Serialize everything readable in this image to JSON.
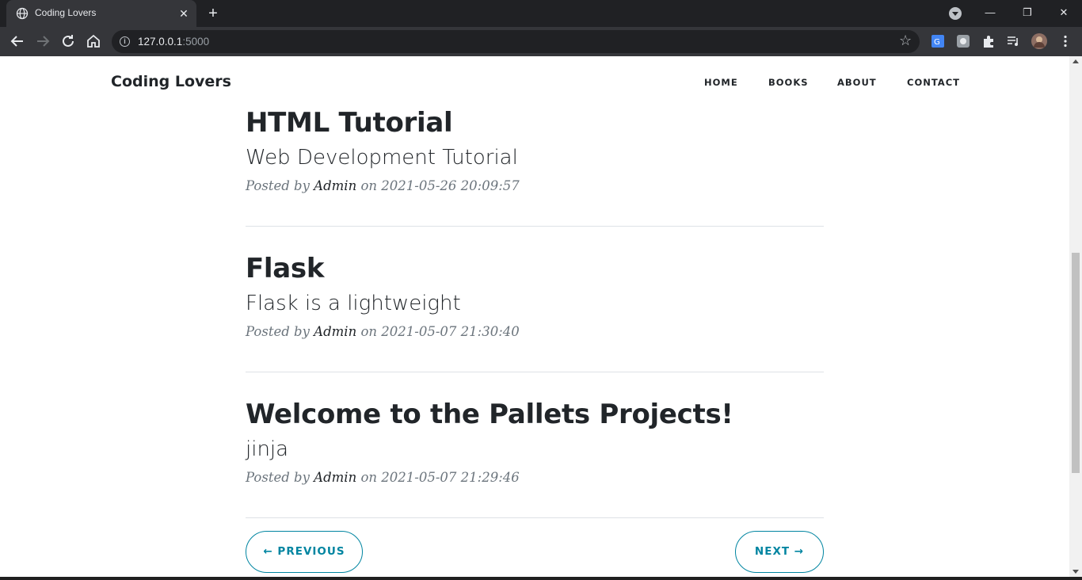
{
  "browser": {
    "tab_title": "Coding Lovers",
    "new_tab_symbol": "+",
    "close_symbol": "✕",
    "url_host": "127.0.0.1",
    "url_port": ":5000",
    "window_controls": {
      "minimize": "—",
      "restore": "❐",
      "close": "✕"
    }
  },
  "site": {
    "brand": "Coding Lovers",
    "nav": [
      "HOME",
      "BOOKS",
      "ABOUT",
      "CONTACT"
    ]
  },
  "posts": [
    {
      "title": "HTML Tutorial",
      "subtitle": "Web Development Tutorial",
      "posted_by": "Posted by",
      "author": "Admin",
      "on": "on",
      "date": "2021-05-26 20:09:57"
    },
    {
      "title": "Flask",
      "subtitle": "Flask is a lightweight",
      "posted_by": "Posted by",
      "author": "Admin",
      "on": "on",
      "date": "2021-05-07 21:30:40"
    },
    {
      "title": "Welcome to the Pallets Projects!",
      "subtitle": "jinja",
      "posted_by": "Posted by",
      "author": "Admin",
      "on": "on",
      "date": "2021-05-07 21:29:46"
    }
  ],
  "pager": {
    "previous": "← PREVIOUS",
    "next": "NEXT →"
  },
  "colors": {
    "accent": "#0085a1",
    "chrome_dark": "#202124",
    "chrome_toolbar": "#35363a",
    "text": "#212529",
    "muted": "#6c757d"
  }
}
